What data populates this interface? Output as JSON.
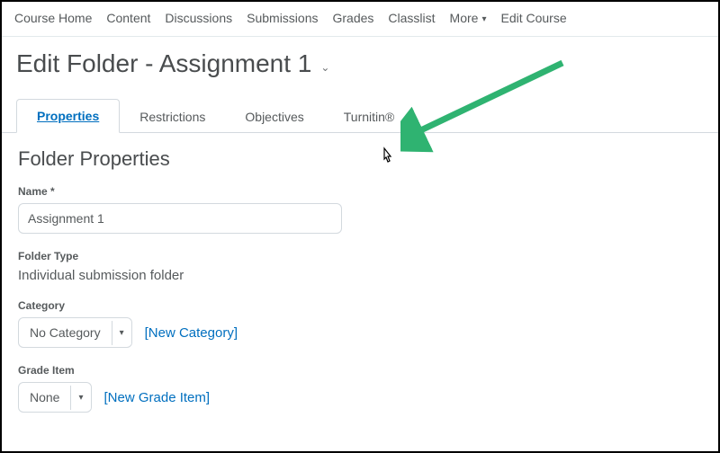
{
  "nav": {
    "items": [
      "Course Home",
      "Content",
      "Discussions",
      "Submissions",
      "Grades",
      "Classlist"
    ],
    "more": "More",
    "edit_course": "Edit Course"
  },
  "page": {
    "title": "Edit Folder - Assignment 1"
  },
  "tabs": {
    "properties": "Properties",
    "restrictions": "Restrictions",
    "objectives": "Objectives",
    "turnitin": "Turnitin®"
  },
  "section": {
    "title": "Folder Properties"
  },
  "form": {
    "name_label": "Name *",
    "name_value": "Assignment 1",
    "folder_type_label": "Folder Type",
    "folder_type_value": "Individual submission folder",
    "category_label": "Category",
    "category_value": "No Category",
    "new_category": "[New Category]",
    "grade_item_label": "Grade Item",
    "grade_item_value": "None",
    "new_grade_item": "[New Grade Item]"
  },
  "colors": {
    "link": "#006fbf",
    "arrow": "#2fb371"
  }
}
